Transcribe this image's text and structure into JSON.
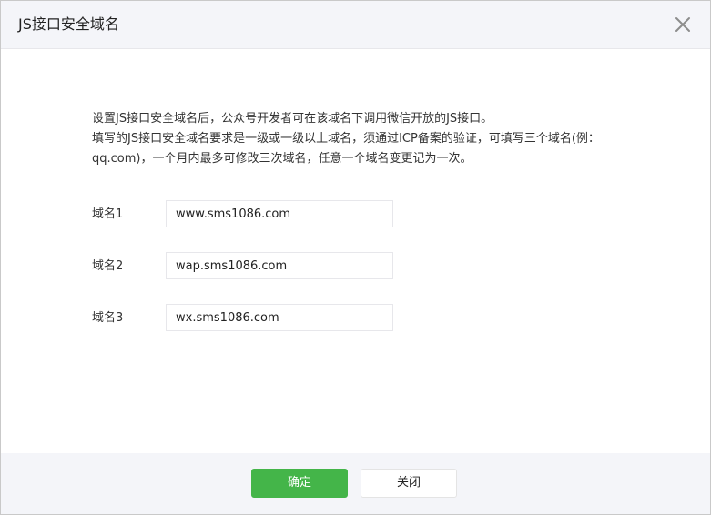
{
  "dialog": {
    "title": "JS接口安全域名",
    "close_icon": "close-icon"
  },
  "description": {
    "line1": "设置JS接口安全域名后，公众号开发者可在该域名下调用微信开放的JS接口。",
    "line2": "填写的JS接口安全域名要求是一级或一级以上域名，须通过ICP备案的验证，可填写三个域名(例：qq.com)，一个月内最多可修改三次域名，任意一个域名变更记为一次。"
  },
  "fields": [
    {
      "label": "域名1",
      "value": "www.sms1086.com"
    },
    {
      "label": "域名2",
      "value": "wap.sms1086.com"
    },
    {
      "label": "域名3",
      "value": "wx.sms1086.com"
    }
  ],
  "footer": {
    "confirm_label": "确定",
    "close_label": "关闭"
  },
  "colors": {
    "primary": "#44b549",
    "header_bg": "#f4f5f9",
    "border": "#e7e7eb"
  }
}
